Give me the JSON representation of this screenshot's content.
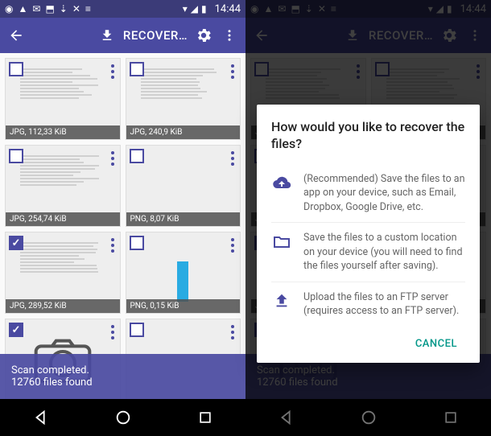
{
  "statusbar": {
    "time": "14:44"
  },
  "appbar": {
    "title": "RECOVER…"
  },
  "tiles": [
    {
      "label": "JPG, 112,33 KiB",
      "checked": false,
      "type": "doc"
    },
    {
      "label": "JPG, 240,9 KiB",
      "checked": false,
      "type": "doc"
    },
    {
      "label": "JPG, 254,74 KiB",
      "checked": false,
      "type": "doc"
    },
    {
      "label": "PNG, 8,07 KiB",
      "checked": false,
      "type": "checker"
    },
    {
      "label": "JPG, 289,52 KiB",
      "checked": true,
      "type": "doc"
    },
    {
      "label": "PNG, 0,15 KiB",
      "checked": false,
      "type": "checker-bar"
    },
    {
      "label": "",
      "checked": true,
      "type": "camera"
    },
    {
      "label": "",
      "checked": false,
      "type": "checker"
    }
  ],
  "footer": {
    "line1": "Scan completed.",
    "line2": "12760 files found"
  },
  "dialog": {
    "title": "How would you like to recover the files?",
    "options": [
      "(Recommended) Save the files to an app on your device, such as Email, Dropbox, Google Drive, etc.",
      "Save the files to a custom location on your device (you will need to find the files yourself after saving).",
      "Upload the files to an FTP server (requires access to an FTP server)."
    ],
    "cancel": "CANCEL"
  }
}
